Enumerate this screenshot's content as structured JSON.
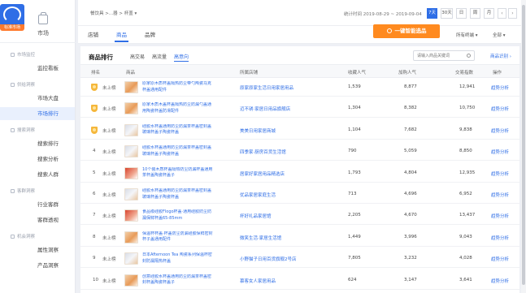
{
  "brand": {
    "tag": "标准市场"
  },
  "sidebar": {
    "market_label": "市场",
    "groups": [
      "市场监控",
      "供给洞察",
      "搜索洞察",
      "客群洞察",
      "机会洞察"
    ],
    "items": [
      "监控看板",
      "市场大盘",
      "市场排行",
      "搜索排行",
      "搜索分析",
      "搜索人群",
      "行业客群",
      "客群透视",
      "属性洞察",
      "产品洞察"
    ]
  },
  "header": {
    "breadcrumb": "餐饮具 >...器 > 杯盖 ▾",
    "stat_range": "统计时间 2019-08-29 ~ 2019-09-04",
    "periods": [
      "7天",
      "30天",
      "日",
      "周",
      "月"
    ],
    "active_period": "7天",
    "prev": "‹",
    "next": "›"
  },
  "tabs": [
    "店铺",
    "商品",
    "品牌"
  ],
  "active_tab": "商品",
  "diagnose_button": "一键智能选品",
  "terminal_select": "所有终端 ▾",
  "category_select": "全部 ▾",
  "panel": {
    "title": "商品排行",
    "subtabs": [
      "高交易",
      "高流量",
      "高意向"
    ],
    "active_subtab": "高意向",
    "search_placeholder": "请输入商品关键词",
    "compare": "商品识别 ›"
  },
  "table": {
    "headers": [
      "排名",
      "商品",
      "所属店铺",
      "收藏人气",
      "加购人气",
      "交易指数",
      "操作"
    ],
    "rows": [
      {
        "rank": "1",
        "medal": true,
        "status": "未上榜",
        "name": "原家原木质杯盖隔热防尘带勺陶瓷马克杯盖通用配件",
        "shop": "原家原家生活日用家居用品",
        "fav": "1,539",
        "cart": "8,877",
        "trade": "12,941",
        "op": "趋势分析",
        "thumb": "orange"
      },
      {
        "rank": "2",
        "medal": true,
        "status": "未上榜",
        "name": "原家木质木盖杯盖隔热防尘防漏勺盖通用陶瓷杯盖防滑配件",
        "shop": "迈不锈·家居日用品旗舰店",
        "fav": "1,304",
        "cart": "8,382",
        "trade": "10,750",
        "op": "趋势分析",
        "thumb": "orange"
      },
      {
        "rank": "3",
        "medal": true,
        "status": "未上榜",
        "name": "硅胶水杯盖通用防尘防漏茶杯盖密封盖玻璃杯盖子陶瓷杯盖",
        "shop": "美美日用家居商城",
        "fav": "1,104",
        "cart": "7,682",
        "trade": "9,838",
        "op": "趋势分析",
        "thumb": "alt"
      },
      {
        "rank": "4",
        "medal": false,
        "status": "未上榜",
        "name": "硅胶水杯盖通用防尘防漏茶杯盖密封盖玻璃杯盖子陶瓷杯盖",
        "shop": "四季家·厨房百货生活馆",
        "fav": "790",
        "cart": "5,059",
        "trade": "8,850",
        "op": "趋势分析",
        "thumb": "alt"
      },
      {
        "rank": "5",
        "medal": false,
        "status": "未上榜",
        "name": "10个装木质杯盖隔热防尘防漏杯盖通用茶杯盖陶瓷杯盖子",
        "shop": "居家好家居用品精选店",
        "fav": "1,793",
        "cart": "4,804",
        "trade": "12,935",
        "op": "趋势分析",
        "thumb": "red"
      },
      {
        "rank": "6",
        "medal": false,
        "status": "未上榜",
        "name": "硅胶水杯盖通用防尘防漏茶杯盖密封盖玻璃杯盖子陶瓷杯盖",
        "shop": "优品家居家庭生活",
        "fav": "713",
        "cart": "4,696",
        "trade": "6,952",
        "op": "趋势分析",
        "thumb": "alt"
      },
      {
        "rank": "7",
        "medal": false,
        "status": "未上榜",
        "name": "食品级硅胶Flogo杯盖·通用硅胶防尘防漏保鲜杯盖65-85mm",
        "shop": "杯好礼品家居馆",
        "fav": "2,205",
        "cart": "4,670",
        "trade": "13,437",
        "op": "趋势分析",
        "thumb": "red"
      },
      {
        "rank": "8",
        "medal": false,
        "status": "未上榜",
        "name": "保温杯杯盖·杯盖防尘防漏硅胶保鲜密封杯子盖通用配件",
        "shop": "微笑生活·家居生活馆",
        "fav": "1,449",
        "cart": "3,996",
        "trade": "9,043",
        "op": "趋势分析",
        "thumb": "orange"
      },
      {
        "rank": "9",
        "medal": false,
        "status": "未上榜",
        "name": "日本Afternoon Tea 陶瓷系列保温杯密封防漏隔热杯盖",
        "shop": "小野猫子日用百货旗舰2号店",
        "fav": "7,805",
        "cart": "3,232",
        "trade": "4,028",
        "op": "趋势分析",
        "thumb": "alt"
      },
      {
        "rank": "10",
        "medal": false,
        "status": "未上榜",
        "name": "创意硅胶水杯盖通用防尘防漏茶杯盖密封杯盖陶瓷杯盖子",
        "shop": "慕客女人家居用品",
        "fav": "624",
        "cart": "3,147",
        "trade": "3,641",
        "op": "趋势分析",
        "thumb": "orange"
      }
    ]
  },
  "colors": {
    "accent": "#2f6ee6",
    "orange": "#ff8a1f",
    "medal": "#f5b73b"
  }
}
